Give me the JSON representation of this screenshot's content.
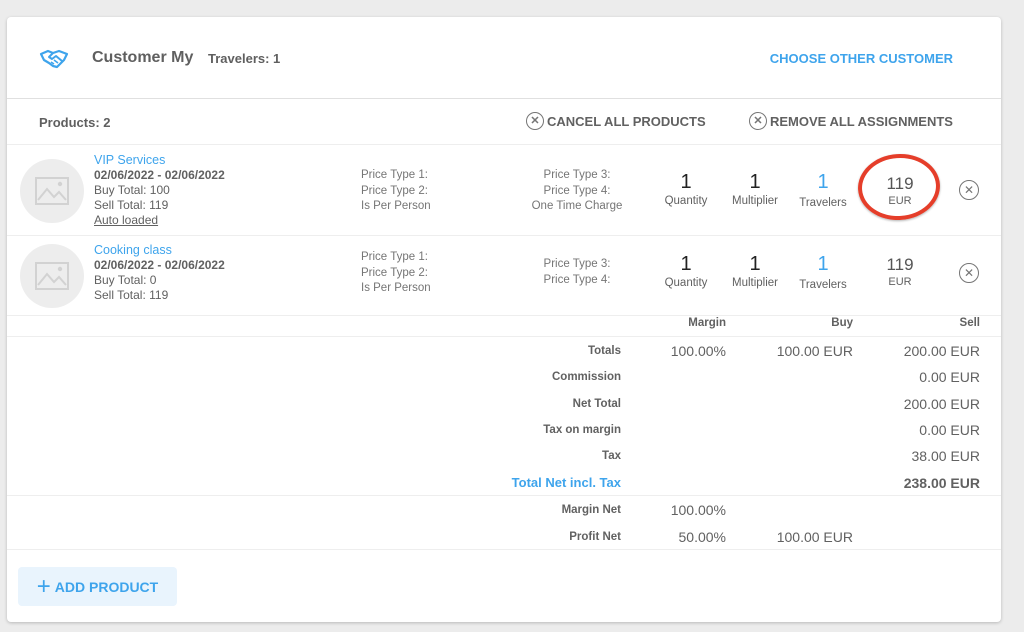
{
  "header": {
    "icon": "handshake-icon",
    "customer_name": "Customer My",
    "travelers": "Travelers: 1",
    "choose_other_customer": "CHOOSE OTHER CUSTOMER"
  },
  "products_bar": {
    "count_label": "Products: 2",
    "cancel_all": "CANCEL ALL PRODUCTS",
    "remove_all_assignments": "REMOVE ALL ASSIGNMENTS"
  },
  "products": [
    {
      "name": "VIP Services",
      "dates": "02/06/2022 - 02/06/2022",
      "buy_total": "Buy Total: 100",
      "sell_total": "Sell Total: 119",
      "auto_loaded": "Auto loaded",
      "price_types_left": [
        "Price Type 1:",
        "Price Type 2:",
        "Is Per Person"
      ],
      "price_types_right": [
        "Price Type 3:",
        "Price Type 4:",
        "One Time Charge"
      ],
      "quantity": "1",
      "quantity_label": "Quantity",
      "multiplier": "1",
      "multiplier_label": "Multiplier",
      "travelers": "1",
      "travelers_label": "Travelers",
      "price": "119",
      "currency": "EUR"
    },
    {
      "name": "Cooking class",
      "dates": "02/06/2022 - 02/06/2022",
      "buy_total": "Buy Total: 0",
      "sell_total": "Sell Total: 119",
      "price_types_left": [
        "Price Type 1:",
        "Price Type 2:",
        "Is Per Person"
      ],
      "price_types_right": [
        "Price Type 3:",
        "Price Type 4:"
      ],
      "quantity": "1",
      "quantity_label": "Quantity",
      "multiplier": "1",
      "multiplier_label": "Multiplier",
      "travelers": "1",
      "travelers_label": "Travelers",
      "price": "119",
      "currency": "EUR"
    }
  ],
  "summary": {
    "columns": {
      "margin": "Margin",
      "buy": "Buy",
      "sell": "Sell"
    },
    "rows": [
      {
        "label": "Totals",
        "margin": "100.00%",
        "buy": "100.00 EUR",
        "sell": "200.00 EUR"
      },
      {
        "label": "Commission",
        "margin": "",
        "buy": "",
        "sell": "0.00 EUR"
      },
      {
        "label": "Net Total",
        "margin": "",
        "buy": "",
        "sell": "200.00 EUR"
      },
      {
        "label": "Tax on margin",
        "margin": "",
        "buy": "",
        "sell": "0.00 EUR"
      },
      {
        "label": "Tax",
        "margin": "",
        "buy": "",
        "sell": "38.00 EUR"
      },
      {
        "label": "Total Net incl. Tax",
        "margin": "",
        "buy": "",
        "sell": "238.00 EUR"
      }
    ],
    "net_rows": [
      {
        "label": "Margin Net",
        "margin": "100.00%",
        "buy": "",
        "sell": ""
      },
      {
        "label": "Profit Net",
        "margin": "50.00%",
        "buy": "100.00 EUR",
        "sell": ""
      }
    ]
  },
  "add_product": "ADD PRODUCT",
  "colors": {
    "accent": "#3ea4ec",
    "highlight": "#e53e2a"
  }
}
